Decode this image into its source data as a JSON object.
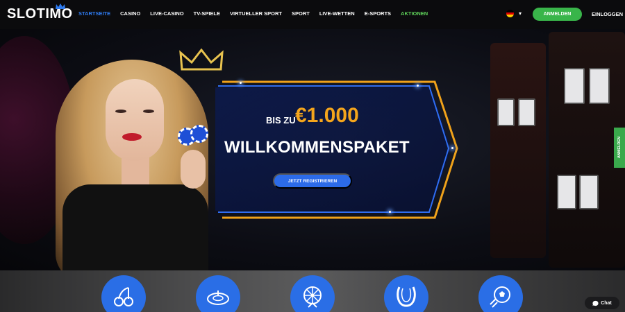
{
  "header": {
    "logo": "SLOTIMO",
    "nav": [
      {
        "label": "STARTSEITE",
        "state": "active"
      },
      {
        "label": "CASINO"
      },
      {
        "label": "LIVE-CASINO"
      },
      {
        "label": "TV-SPIELE"
      },
      {
        "label": "VIRTUELLER SPORT"
      },
      {
        "label": "SPORT"
      },
      {
        "label": "LIVE-WETTEN"
      },
      {
        "label": "E-SPORTS"
      },
      {
        "label": "AKTIONEN",
        "state": "promo"
      }
    ],
    "language": "de-flag-icon",
    "register_label": "ANMELDEN",
    "login_label": "EINLOGGEN"
  },
  "hero": {
    "prefix": "BIS ZU",
    "amount": "€1.000",
    "headline": "WILLKOMMENSPAKET",
    "cta_label": "JETZT REGISTRIEREN"
  },
  "side_tab": {
    "label": "ANMELDEN"
  },
  "categories": [
    {
      "icon": "cherries-icon"
    },
    {
      "icon": "roulette-icon"
    },
    {
      "icon": "wheel-of-fortune-icon"
    },
    {
      "icon": "horseshoe-icon"
    },
    {
      "icon": "soccer-ball-icon"
    }
  ],
  "chat": {
    "label": "Chat",
    "icon": "chat-bubble-icon"
  },
  "colors": {
    "accent_blue": "#2e7bf0",
    "button_green": "#39b54a",
    "promo_green": "#5fd35a",
    "amount_gold": "#f4a51c",
    "category_blue": "#2a6ee6"
  }
}
